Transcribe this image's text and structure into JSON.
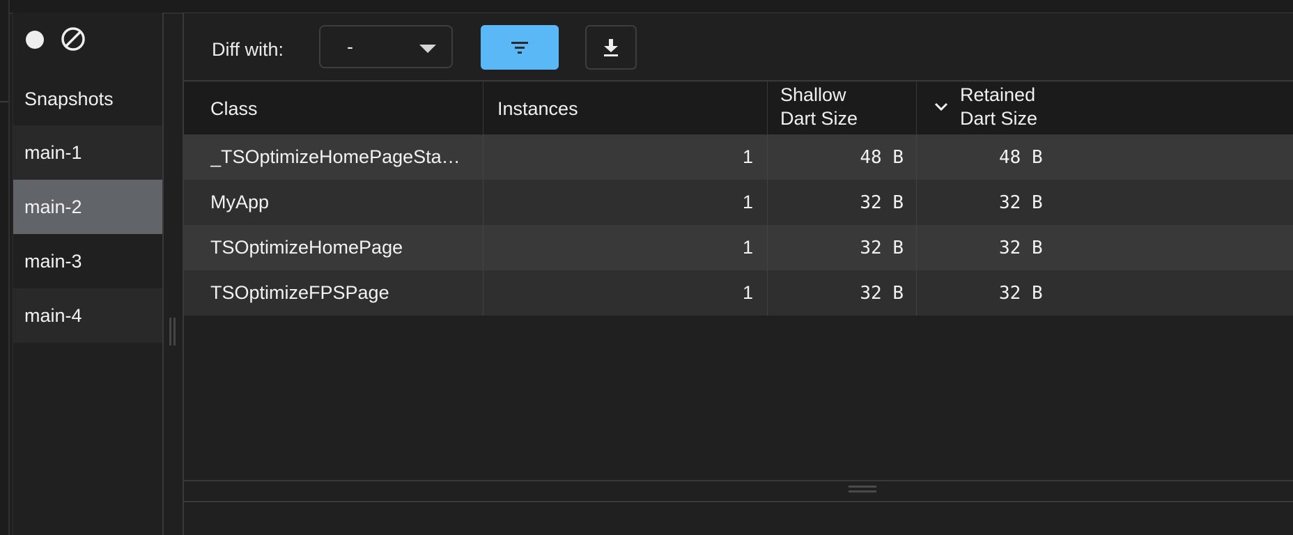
{
  "sidebar": {
    "heading": "Snapshots",
    "items": [
      {
        "label": "main-1"
      },
      {
        "label": "main-2"
      },
      {
        "label": "main-3"
      },
      {
        "label": "main-4"
      }
    ],
    "selected": "main-2"
  },
  "toolbar": {
    "diff_label": "Diff with:",
    "diff_value": "-",
    "accent_color": "#5bb8f6"
  },
  "table": {
    "headers": {
      "class": "Class",
      "instances": "Instances",
      "shallow_line1": "Shallow",
      "shallow_line2": "Dart Size",
      "retained_line1": "Retained",
      "retained_line2": "Dart Size"
    },
    "sort_column": "Retained Dart Size",
    "sort_direction": "descending",
    "rows": [
      {
        "class": "_TSOptimizeHomePageSta…",
        "instances": "1",
        "shallow": "48  B",
        "retained": "48  B"
      },
      {
        "class": "MyApp",
        "instances": "1",
        "shallow": "32  B",
        "retained": "32  B"
      },
      {
        "class": "TSOptimizeHomePage",
        "instances": "1",
        "shallow": "32  B",
        "retained": "32  B"
      },
      {
        "class": "TSOptimizeFPSPage",
        "instances": "1",
        "shallow": "32  B",
        "retained": "32  B"
      }
    ]
  }
}
